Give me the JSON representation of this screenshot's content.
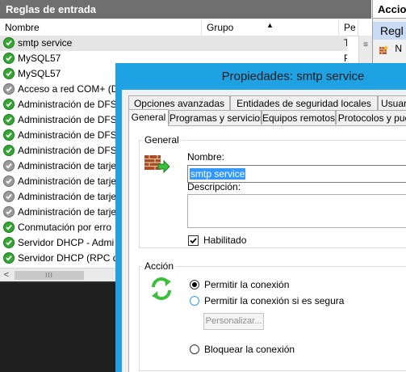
{
  "rules_panel": {
    "title": "Reglas de entrada",
    "columns": [
      {
        "label": "Nombre"
      },
      {
        "label": "Grupo"
      },
      {
        "label": "Pe"
      }
    ],
    "sort_icon": "sort-ascending-arrow-icon",
    "rows": [
      {
        "name": "smtp service",
        "profile": "To",
        "enabled": true,
        "selected": true
      },
      {
        "name": "MySQL57",
        "profile": "Pri",
        "enabled": true
      },
      {
        "name": "MySQL57",
        "profile": "",
        "enabled": true
      },
      {
        "name": "Acceso a red COM+ (D",
        "profile": "",
        "enabled": false
      },
      {
        "name": "Administración de DFS",
        "profile": "",
        "enabled": true
      },
      {
        "name": "Administración de DFS",
        "profile": "",
        "enabled": true
      },
      {
        "name": "Administración de DFS",
        "profile": "",
        "enabled": true
      },
      {
        "name": "Administración de DFS",
        "profile": "",
        "enabled": true
      },
      {
        "name": "Administración de tarje",
        "profile": "",
        "enabled": false
      },
      {
        "name": "Administración de tarje",
        "profile": "",
        "enabled": false
      },
      {
        "name": "Administración de tarje",
        "profile": "",
        "enabled": false
      },
      {
        "name": "Administración de tarje",
        "profile": "",
        "enabled": false
      },
      {
        "name": "Conmutación por erro",
        "profile": "",
        "enabled": true
      },
      {
        "name": "Servidor DHCP - Admi",
        "profile": "",
        "enabled": true
      },
      {
        "name": "Servidor DHCP (RPC de",
        "profile": "",
        "enabled": true
      }
    ]
  },
  "actions_pane": {
    "header": "Accion",
    "selected": "Regl",
    "item": "N"
  },
  "dialog": {
    "title": "Propiedades: smtp service",
    "tabs_row1": [
      "Opciones avanzadas",
      "Entidades de seguridad locales",
      "Usuar"
    ],
    "tabs_row2": [
      "General",
      "Programas y servicios",
      "Equipos remotos",
      "Protocolos y pue"
    ],
    "active_tab": "General",
    "general_group": {
      "label": "General",
      "icon": "firewall-rule-icon",
      "name_label": "Nombre:",
      "name_value": "smtp service",
      "description_label": "Descripción:",
      "description_value": "",
      "enabled_label": "Habilitado",
      "enabled": true
    },
    "action_group": {
      "label": "Acción",
      "icon": "allow-connection-arrows-icon",
      "options": [
        {
          "label": "Permitir la conexión",
          "selected": true
        },
        {
          "label": "Permitir la conexión si es segura",
          "selected": false
        },
        {
          "label": "Bloquear la conexión",
          "selected": false
        }
      ],
      "customize_label": "Personalizar..."
    }
  },
  "colors": {
    "dialog_frame": "#1fa2e4",
    "panel_header": "#6f6f6f",
    "rule_enabled": "#35a534",
    "rule_disabled": "#9a9a9a",
    "selection": "#3399ff"
  }
}
